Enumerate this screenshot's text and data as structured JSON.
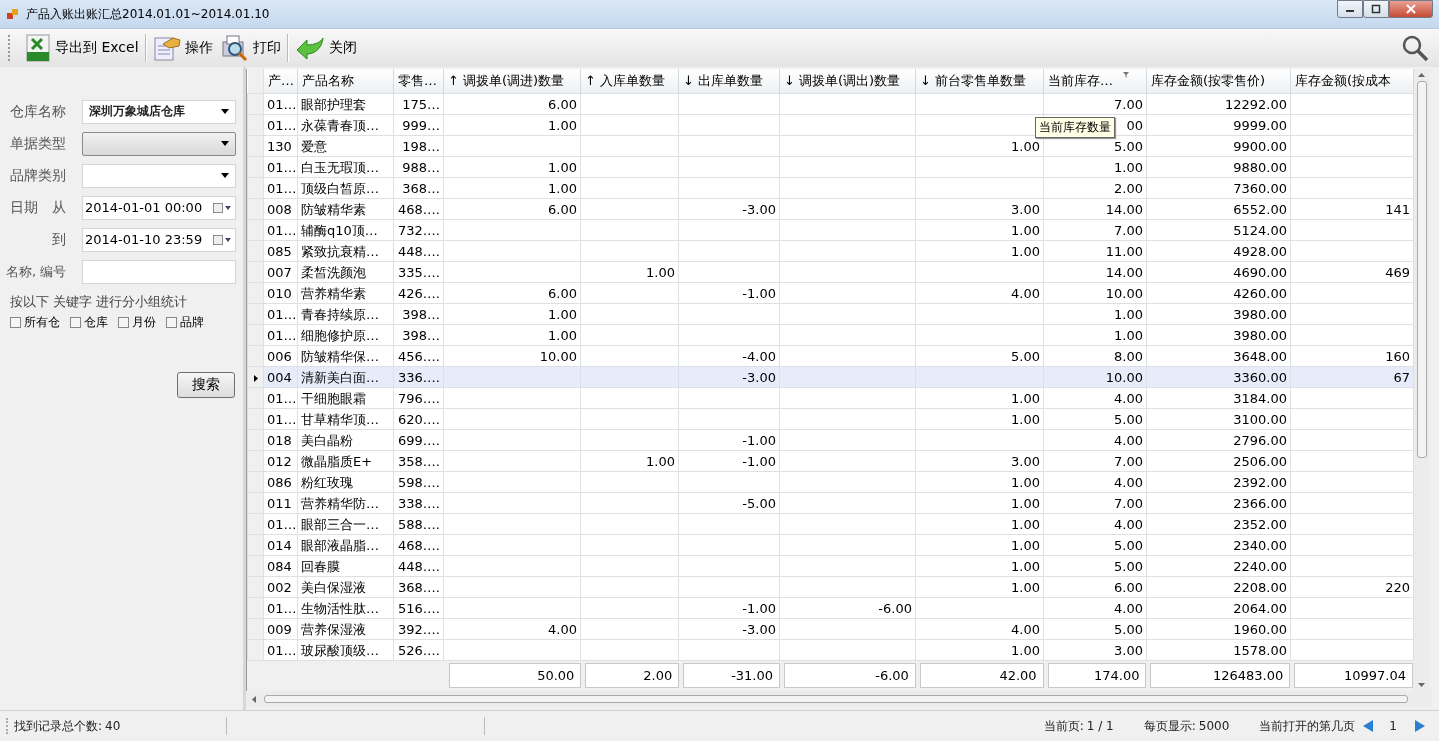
{
  "window": {
    "title": "产品入账出账汇总2014.01.01~2014.01.10"
  },
  "toolbar": {
    "buttons": [
      {
        "label": "导出到 Excel",
        "kind": "excel"
      },
      {
        "label": "操作",
        "kind": "operate"
      },
      {
        "label": "打印",
        "kind": "print"
      },
      {
        "label": "关闭",
        "kind": "close"
      }
    ]
  },
  "filters": {
    "combos": [
      {
        "label": "仓库名称",
        "value": "深圳万象城店仓库",
        "kind": "combo"
      },
      {
        "label": "单据类型",
        "kind": "button-combo"
      },
      {
        "label": "品牌类别",
        "kind": "combo"
      }
    ],
    "date_label": "日期",
    "from_label": "从",
    "from": "2014-01-01 00:00",
    "to_label": "到",
    "to": "2014-01-10 23:59",
    "name_label": "名称, 编号",
    "group_label": "按以下 关键字 进行分小组统计",
    "group_options": [
      {
        "label": "所有仓",
        "checked": false
      },
      {
        "label": "仓库",
        "checked": false
      },
      {
        "label": "月份",
        "checked": false
      },
      {
        "label": "品牌",
        "checked": false
      }
    ],
    "search_button": "搜索"
  },
  "table": {
    "columns": [
      {
        "label": "产…",
        "filtered": false
      },
      {
        "label": "产品名称",
        "filtered": false
      },
      {
        "label": "零售…",
        "filtered": false
      },
      {
        "label": "↑ 调拨单(调进)数量",
        "filtered": false
      },
      {
        "label": "↑ 入库单数量",
        "filtered": false
      },
      {
        "label": "↓ 出库单数量",
        "filtered": false
      },
      {
        "label": "↓ 调拨单(调出)数量",
        "filtered": false
      },
      {
        "label": "↓ 前台零售单数量",
        "filtered": false
      },
      {
        "label": "当前库存…",
        "filtered": true
      },
      {
        "label": "库存金额(按零售价)",
        "filtered": false
      },
      {
        "label": "库存金额(按成本",
        "filtered": false
      }
    ],
    "rows": [
      {
        "selected": false,
        "cells": [
          "01…",
          "眼部护理套",
          "175…",
          "6.00",
          null,
          null,
          null,
          null,
          "7.00",
          "12292.00",
          null
        ]
      },
      {
        "selected": false,
        "cells": [
          "01…",
          "永葆青春顶…",
          "999…",
          "1.00",
          null,
          null,
          null,
          null,
          "00",
          "9999.00",
          null
        ]
      },
      {
        "selected": false,
        "cells": [
          "130",
          "爱意",
          "198…",
          null,
          null,
          null,
          null,
          "1.00",
          "5.00",
          "9900.00",
          null
        ]
      },
      {
        "selected": false,
        "cells": [
          "01…",
          "白玉无瑕顶…",
          "988…",
          "1.00",
          null,
          null,
          null,
          null,
          "1.00",
          "9880.00",
          null
        ]
      },
      {
        "selected": false,
        "cells": [
          "01…",
          "顶级白皙原…",
          "368…",
          "1.00",
          null,
          null,
          null,
          null,
          "2.00",
          "7360.00",
          null
        ]
      },
      {
        "selected": false,
        "cells": [
          "008",
          "防皱精华素",
          "468….",
          "6.00",
          null,
          "-3.00",
          null,
          "3.00",
          "14.00",
          "6552.00",
          "141"
        ]
      },
      {
        "selected": false,
        "cells": [
          "01…",
          "辅酶q10顶…",
          "732….",
          null,
          null,
          null,
          null,
          "1.00",
          "7.00",
          "5124.00",
          null
        ]
      },
      {
        "selected": false,
        "cells": [
          "085",
          "紧致抗衰精…",
          "448….",
          null,
          null,
          null,
          null,
          "1.00",
          "11.00",
          "4928.00",
          null
        ]
      },
      {
        "selected": false,
        "cells": [
          "007",
          "柔皙洗颜泡",
          "335….",
          null,
          "1.00",
          null,
          null,
          null,
          "14.00",
          "4690.00",
          "469"
        ]
      },
      {
        "selected": false,
        "cells": [
          "010",
          "营养精华素",
          "426….",
          "6.00",
          null,
          "-1.00",
          null,
          "4.00",
          "10.00",
          "4260.00",
          null
        ]
      },
      {
        "selected": false,
        "cells": [
          "01…",
          "青春持续原…",
          "398…",
          "1.00",
          null,
          null,
          null,
          null,
          "1.00",
          "3980.00",
          null
        ]
      },
      {
        "selected": false,
        "cells": [
          "01…",
          "细胞修护原…",
          "398…",
          "1.00",
          null,
          null,
          null,
          null,
          "1.00",
          "3980.00",
          null
        ]
      },
      {
        "selected": false,
        "cells": [
          "006",
          "防皱精华保…",
          "456….",
          "10.00",
          null,
          "-4.00",
          null,
          "5.00",
          "8.00",
          "3648.00",
          "160"
        ]
      },
      {
        "selected": true,
        "cells": [
          "004",
          "清新美白面…",
          "336….",
          null,
          null,
          "-3.00",
          null,
          null,
          "10.00",
          "3360.00",
          "67"
        ]
      },
      {
        "selected": false,
        "cells": [
          "01…",
          "干细胞眼霜",
          "796….",
          null,
          null,
          null,
          null,
          "1.00",
          "4.00",
          "3184.00",
          null
        ]
      },
      {
        "selected": false,
        "cells": [
          "01…",
          "甘草精华顶…",
          "620….",
          null,
          null,
          null,
          null,
          "1.00",
          "5.00",
          "3100.00",
          null
        ]
      },
      {
        "selected": false,
        "cells": [
          "018",
          "美白晶粉",
          "699….",
          null,
          null,
          "-1.00",
          null,
          null,
          "4.00",
          "2796.00",
          null
        ]
      },
      {
        "selected": false,
        "cells": [
          "012",
          "微晶脂质E+",
          "358….",
          null,
          "1.00",
          "-1.00",
          null,
          "3.00",
          "7.00",
          "2506.00",
          null
        ]
      },
      {
        "selected": false,
        "cells": [
          "086",
          "粉红玫瑰",
          "598….",
          null,
          null,
          null,
          null,
          "1.00",
          "4.00",
          "2392.00",
          null
        ]
      },
      {
        "selected": false,
        "cells": [
          "011",
          "营养精华防…",
          "338….",
          null,
          null,
          "-5.00",
          null,
          "1.00",
          "7.00",
          "2366.00",
          null
        ]
      },
      {
        "selected": false,
        "cells": [
          "01…",
          "眼部三合一…",
          "588….",
          null,
          null,
          null,
          null,
          "1.00",
          "4.00",
          "2352.00",
          null
        ]
      },
      {
        "selected": false,
        "cells": [
          "014",
          "眼部液晶脂…",
          "468….",
          null,
          null,
          null,
          null,
          "1.00",
          "5.00",
          "2340.00",
          null
        ]
      },
      {
        "selected": false,
        "cells": [
          "084",
          "回春膜",
          "448….",
          null,
          null,
          null,
          null,
          "1.00",
          "5.00",
          "2240.00",
          null
        ]
      },
      {
        "selected": false,
        "cells": [
          "002",
          "美白保湿液",
          "368….",
          null,
          null,
          null,
          null,
          "1.00",
          "6.00",
          "2208.00",
          "220"
        ]
      },
      {
        "selected": false,
        "cells": [
          "01…",
          "生物活性肽…",
          "516….",
          null,
          null,
          "-1.00",
          "-6.00",
          null,
          "4.00",
          "2064.00",
          null
        ]
      },
      {
        "selected": false,
        "cells": [
          "009",
          "营养保湿液",
          "392….",
          "4.00",
          null,
          "-3.00",
          null,
          "4.00",
          "5.00",
          "1960.00",
          null
        ]
      },
      {
        "selected": false,
        "cells": [
          "01…",
          "玻尿酸顶级…",
          "526….",
          null,
          null,
          null,
          null,
          "1.00",
          "3.00",
          "1578.00",
          null
        ]
      }
    ],
    "totals": [
      "50.00",
      "2.00",
      "-31.00",
      "-6.00",
      "42.00",
      "174.00",
      "126483.00",
      "10997.04"
    ],
    "tooltip": "当前库存数量"
  },
  "status_bar": {
    "count_label": "找到记录总个数:",
    "count": "40",
    "page_label": "当前页:",
    "page": "1 / 1",
    "per_page_label": "每页显示:",
    "per_page": "5000",
    "open_page_label": "当前打开的第几页",
    "open_page": "1"
  }
}
